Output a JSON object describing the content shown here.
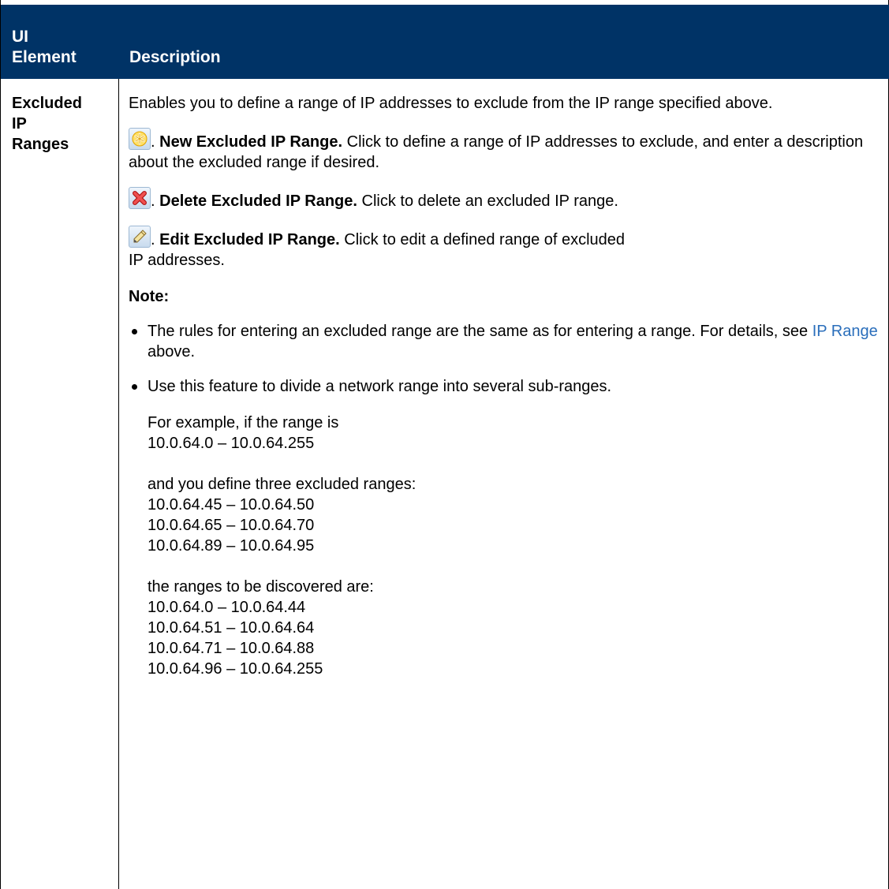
{
  "header": {
    "col1_line1": "UI",
    "col1_line2": "Element",
    "col2": "Description"
  },
  "row": {
    "name_line1": "Excluded",
    "name_line2": "IP",
    "name_line3": "Ranges",
    "intro": "Enables you to define a range of IP addresses to exclude from the IP range specified above.",
    "actions": [
      {
        "icon": "new-asterisk-icon",
        "title": "New Excluded IP Range.",
        "text": " Click to define a range of IP addresses to exclude, and enter a description about the excluded range if desired."
      },
      {
        "icon": "delete-x-icon",
        "title": "Delete Excluded IP Range.",
        "text": " Click to delete an excluded IP range."
      },
      {
        "icon": "edit-pencil-icon",
        "title": "Edit Excluded IP Range.",
        "text_line1": " Click to edit a defined range of excluded",
        "text_line2": "IP addresses."
      }
    ],
    "note_label": "Note:",
    "bullets": {
      "b1_text": "The rules for entering an excluded range are the same as for entering a range. For details, see ",
      "b1_link": "IP Range",
      "b1_after": " above.",
      "b2_text": "Use this feature to divide a network range into several sub-ranges."
    },
    "example": {
      "p1_line1": "For example, if the range is",
      "p1_line2": "10.0.64.0 – 10.0.64.255",
      "p2_line1": "and you define three excluded ranges:",
      "excluded": [
        "10.0.64.45 – 10.0.64.50",
        "10.0.64.65 – 10.0.64.70",
        "10.0.64.89 – 10.0.64.95"
      ],
      "p3_line1": "the ranges to be discovered are:",
      "discovered": [
        "10.0.64.0 – 10.0.64.44",
        "10.0.64.51 – 10.0.64.64",
        "10.0.64.71 – 10.0.64.88",
        "10.0.64.96 – 10.0.64.255"
      ]
    }
  },
  "colors": {
    "header_bg": "#003366",
    "link": "#2a6ebb"
  }
}
